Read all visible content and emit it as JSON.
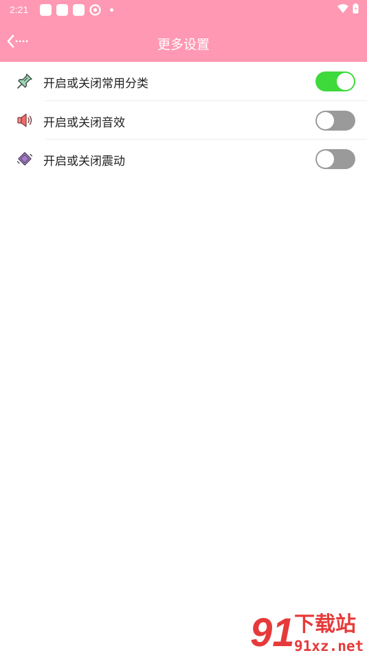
{
  "status_bar": {
    "time": "2:21"
  },
  "header": {
    "title": "更多设置"
  },
  "settings": [
    {
      "label": "开启或关闭常用分类",
      "icon": "pushpin-icon",
      "enabled": true
    },
    {
      "label": "开启或关闭音效",
      "icon": "speaker-icon",
      "enabled": false
    },
    {
      "label": "开启或关闭震动",
      "icon": "vibrate-phone-icon",
      "enabled": false
    }
  ],
  "watermark": {
    "brand": "下载站",
    "site": "91xz.net",
    "logo_text": "91"
  },
  "colors": {
    "accent": "#ff98b2",
    "toggle_on": "#3ed93b",
    "toggle_off": "#9a9a9a"
  }
}
